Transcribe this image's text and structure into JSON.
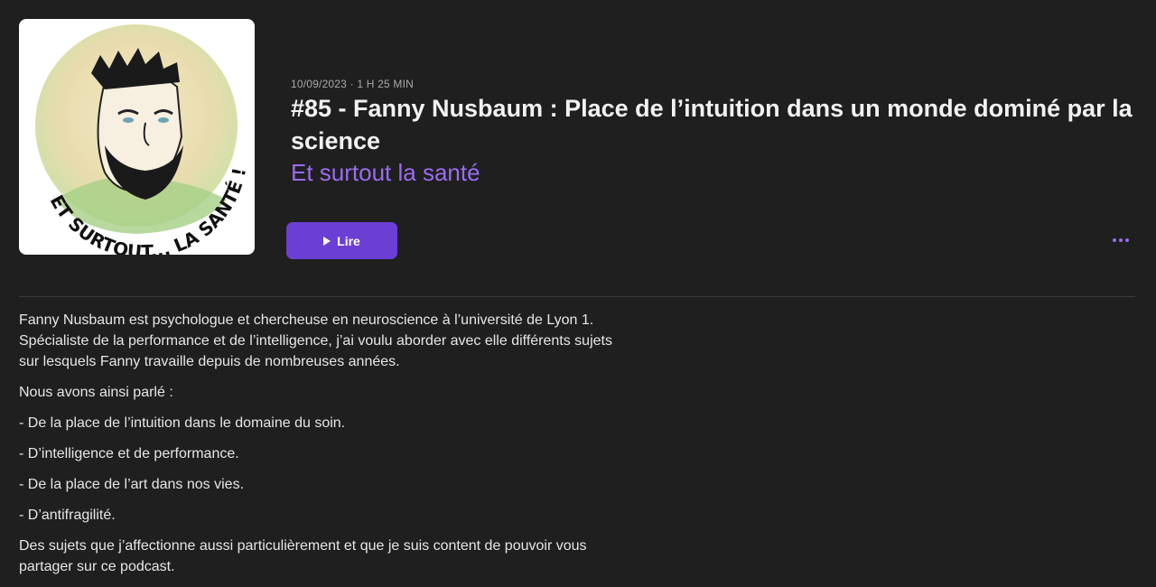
{
  "episode": {
    "meta": "10/09/2023 · 1 H 25 MIN",
    "title": "#85 - Fanny Nusbaum : Place de l’intuition dans un monde dominé par la science",
    "show_name": "Et surtout la santé",
    "artwork_text": "ET SURTOUT... LA SANTÉ !"
  },
  "actions": {
    "play_label": "Lire",
    "more_icon": "ellipsis-icon",
    "play_icon": "play-icon"
  },
  "description": {
    "paragraphs": [
      "Fanny Nusbaum est psychologue et chercheuse en neuroscience à l’université de Lyon 1. Spécialiste de la performance et de l’intelligence, j’ai voulu aborder avec elle différents sujets sur lesquels Fanny travaille depuis de nombreuses années.",
      "Nous avons ainsi parlé :",
      "- De la place de l’intuition dans le domaine du soin.",
      "-  D’intelligence et de performance.",
      "-  De la place de l’art dans nos vies.",
      "-  D’antifragilité.",
      "Des sujets que j’affectionne aussi particulièrement et que je suis content de pouvoir vous partager sur ce podcast."
    ]
  },
  "colors": {
    "background": "#1f1f1f",
    "accent": "#9b6cf0",
    "button": "#6b3fd3"
  }
}
